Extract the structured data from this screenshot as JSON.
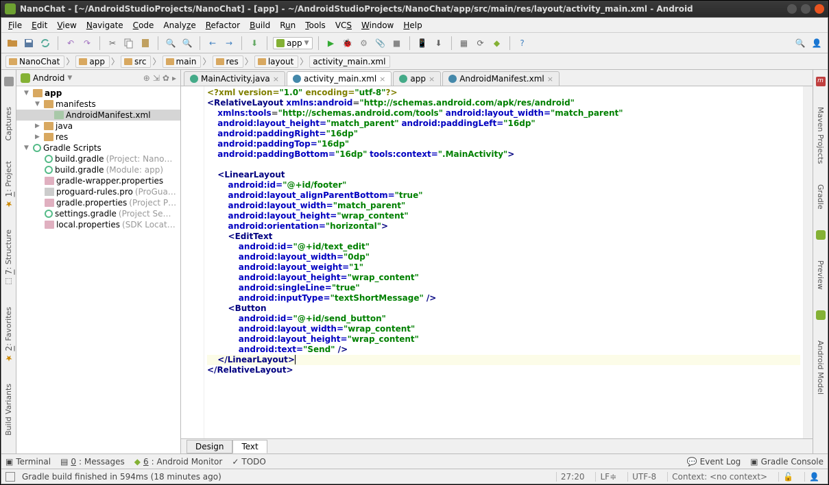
{
  "titlebar": "NanoChat - [~/AndroidStudioProjects/NanoChat] - [app] - ~/AndroidStudioProjects/NanoChat/app/src/main/res/layout/activity_main.xml - Android",
  "menu": [
    "File",
    "Edit",
    "View",
    "Navigate",
    "Code",
    "Analyze",
    "Refactor",
    "Build",
    "Run",
    "Tools",
    "VCS",
    "Window",
    "Help"
  ],
  "breadcrumb": [
    "NanoChat",
    "app",
    "src",
    "main",
    "res",
    "layout",
    "activity_main.xml"
  ],
  "project": {
    "mode": "Android",
    "tree": {
      "app": "app",
      "manifests": "manifests",
      "manifest_file": "AndroidManifest.xml",
      "java": "java",
      "res": "res",
      "gradle_scripts": "Gradle Scripts",
      "build_gradle_proj": "build.gradle",
      "build_gradle_proj_note": "(Project: Nano…",
      "build_gradle_mod": "build.gradle",
      "build_gradle_mod_note": "(Module: app)",
      "wrapper": "gradle-wrapper.properties",
      "proguard": "proguard-rules.pro",
      "proguard_note": "(ProGua…",
      "gradle_props": "gradle.properties",
      "gradle_props_note": "(Project P…",
      "settings": "settings.gradle",
      "settings_note": "(Project Se…",
      "local": "local.properties",
      "local_note": "(SDK Locat…"
    }
  },
  "tabs": [
    {
      "label": "MainActivity.java",
      "active": false,
      "color": "#4a8"
    },
    {
      "label": "activity_main.xml",
      "active": true,
      "color": "#48a"
    },
    {
      "label": "app",
      "active": false,
      "color": "#4a8"
    },
    {
      "label": "AndroidManifest.xml",
      "active": false,
      "color": "#48a"
    }
  ],
  "editor_bottom_tabs": {
    "design": "Design",
    "text": "Text"
  },
  "left_gutter": [
    "Captures",
    "1: Project",
    "7: Structure",
    "2: Favorites",
    "Build Variants"
  ],
  "right_gutter": [
    "Maven Projects",
    "Gradle",
    "Preview",
    "Android Model"
  ],
  "run_config": "app",
  "bottom_bar": {
    "terminal": "Terminal",
    "messages": "0: Messages",
    "android_monitor": "6: Android Monitor",
    "todo": "TODO",
    "event_log": "Event Log",
    "gradle_console": "Gradle Console"
  },
  "status": {
    "text": "Gradle build finished in 594ms (18 minutes ago)",
    "pos": "27:20",
    "le": "LF≑",
    "enc": "UTF-8",
    "context": "Context: <no context>"
  },
  "code": {
    "l1_a": "<?",
    "l1_b": "xml version=",
    "l1_c": "\"1.0\"",
    "l1_d": " encoding=",
    "l1_e": "\"utf-8\"",
    "l1_f": "?>",
    "l2_a": "<RelativeLayout ",
    "l2_b": "xmlns:",
    "l2_c": "android",
    "l2_d": "=",
    "l2_e": "\"http://schemas.android.com/apk/res/android\"",
    "l3_a": "    ",
    "l3_b": "xmlns:",
    "l3_c": "tools",
    "l3_d": "=",
    "l3_e": "\"http://schemas.android.com/tools\"",
    "l3_f": " ",
    "l3_g": "android",
    "l3_h": ":layout_width=",
    "l3_i": "\"match_parent\"",
    "l4_a": "    ",
    "l4_b": "android",
    "l4_c": ":layout_height=",
    "l4_d": "\"match_parent\"",
    "l4_e": " ",
    "l4_f": "android",
    "l4_g": ":paddingLeft=",
    "l4_h": "\"16dp\"",
    "l5_a": "    ",
    "l5_b": "android",
    "l5_c": ":paddingRight=",
    "l5_d": "\"16dp\"",
    "l6_a": "    ",
    "l6_b": "android",
    "l6_c": ":paddingTop=",
    "l6_d": "\"16dp\"",
    "l7_a": "    ",
    "l7_b": "android",
    "l7_c": ":paddingBottom=",
    "l7_d": "\"16dp\"",
    "l7_e": " ",
    "l7_f": "tools",
    "l7_g": ":context=",
    "l7_h": "\".MainActivity\"",
    "l7_i": ">",
    "l9_a": "    ",
    "l9_b": "<LinearLayout",
    "l10_a": "        ",
    "l10_b": "android",
    "l10_c": ":id=",
    "l10_d": "\"@+id/footer\"",
    "l11_a": "        ",
    "l11_b": "android",
    "l11_c": ":layout_alignParentBottom=",
    "l11_d": "\"true\"",
    "l12_a": "        ",
    "l12_b": "android",
    "l12_c": ":layout_width=",
    "l12_d": "\"match_parent\"",
    "l13_a": "        ",
    "l13_b": "android",
    "l13_c": ":layout_height=",
    "l13_d": "\"wrap_content\"",
    "l14_a": "        ",
    "l14_b": "android",
    "l14_c": ":orientation=",
    "l14_d": "\"horizontal\"",
    "l14_e": ">",
    "l15_a": "        ",
    "l15_b": "<EditText",
    "l16_a": "            ",
    "l16_b": "android",
    "l16_c": ":id=",
    "l16_d": "\"@+id/text_edit\"",
    "l17_a": "            ",
    "l17_b": "android",
    "l17_c": ":layout_width=",
    "l17_d": "\"0dp\"",
    "l18_a": "            ",
    "l18_b": "android",
    "l18_c": ":layout_weight=",
    "l18_d": "\"1\"",
    "l19_a": "            ",
    "l19_b": "android",
    "l19_c": ":layout_height=",
    "l19_d": "\"wrap_content\"",
    "l20_a": "            ",
    "l20_b": "android",
    "l20_c": ":singleLine=",
    "l20_d": "\"true\"",
    "l21_a": "            ",
    "l21_b": "android",
    "l21_c": ":inputType=",
    "l21_d": "\"textShortMessage\"",
    "l21_e": " />",
    "l22_a": "        ",
    "l22_b": "<Button",
    "l23_a": "            ",
    "l23_b": "android",
    "l23_c": ":id=",
    "l23_d": "\"@+id/send_button\"",
    "l24_a": "            ",
    "l24_b": "android",
    "l24_c": ":layout_width=",
    "l24_d": "\"wrap_content\"",
    "l25_a": "            ",
    "l25_b": "android",
    "l25_c": ":layout_height=",
    "l25_d": "\"wrap_content\"",
    "l26_a": "            ",
    "l26_b": "android",
    "l26_c": ":text=",
    "l26_d": "\"Send\"",
    "l26_e": " />",
    "l27_a": "    ",
    "l27_b": "</LinearLayout>",
    "l28_a": "</RelativeLayout>"
  }
}
